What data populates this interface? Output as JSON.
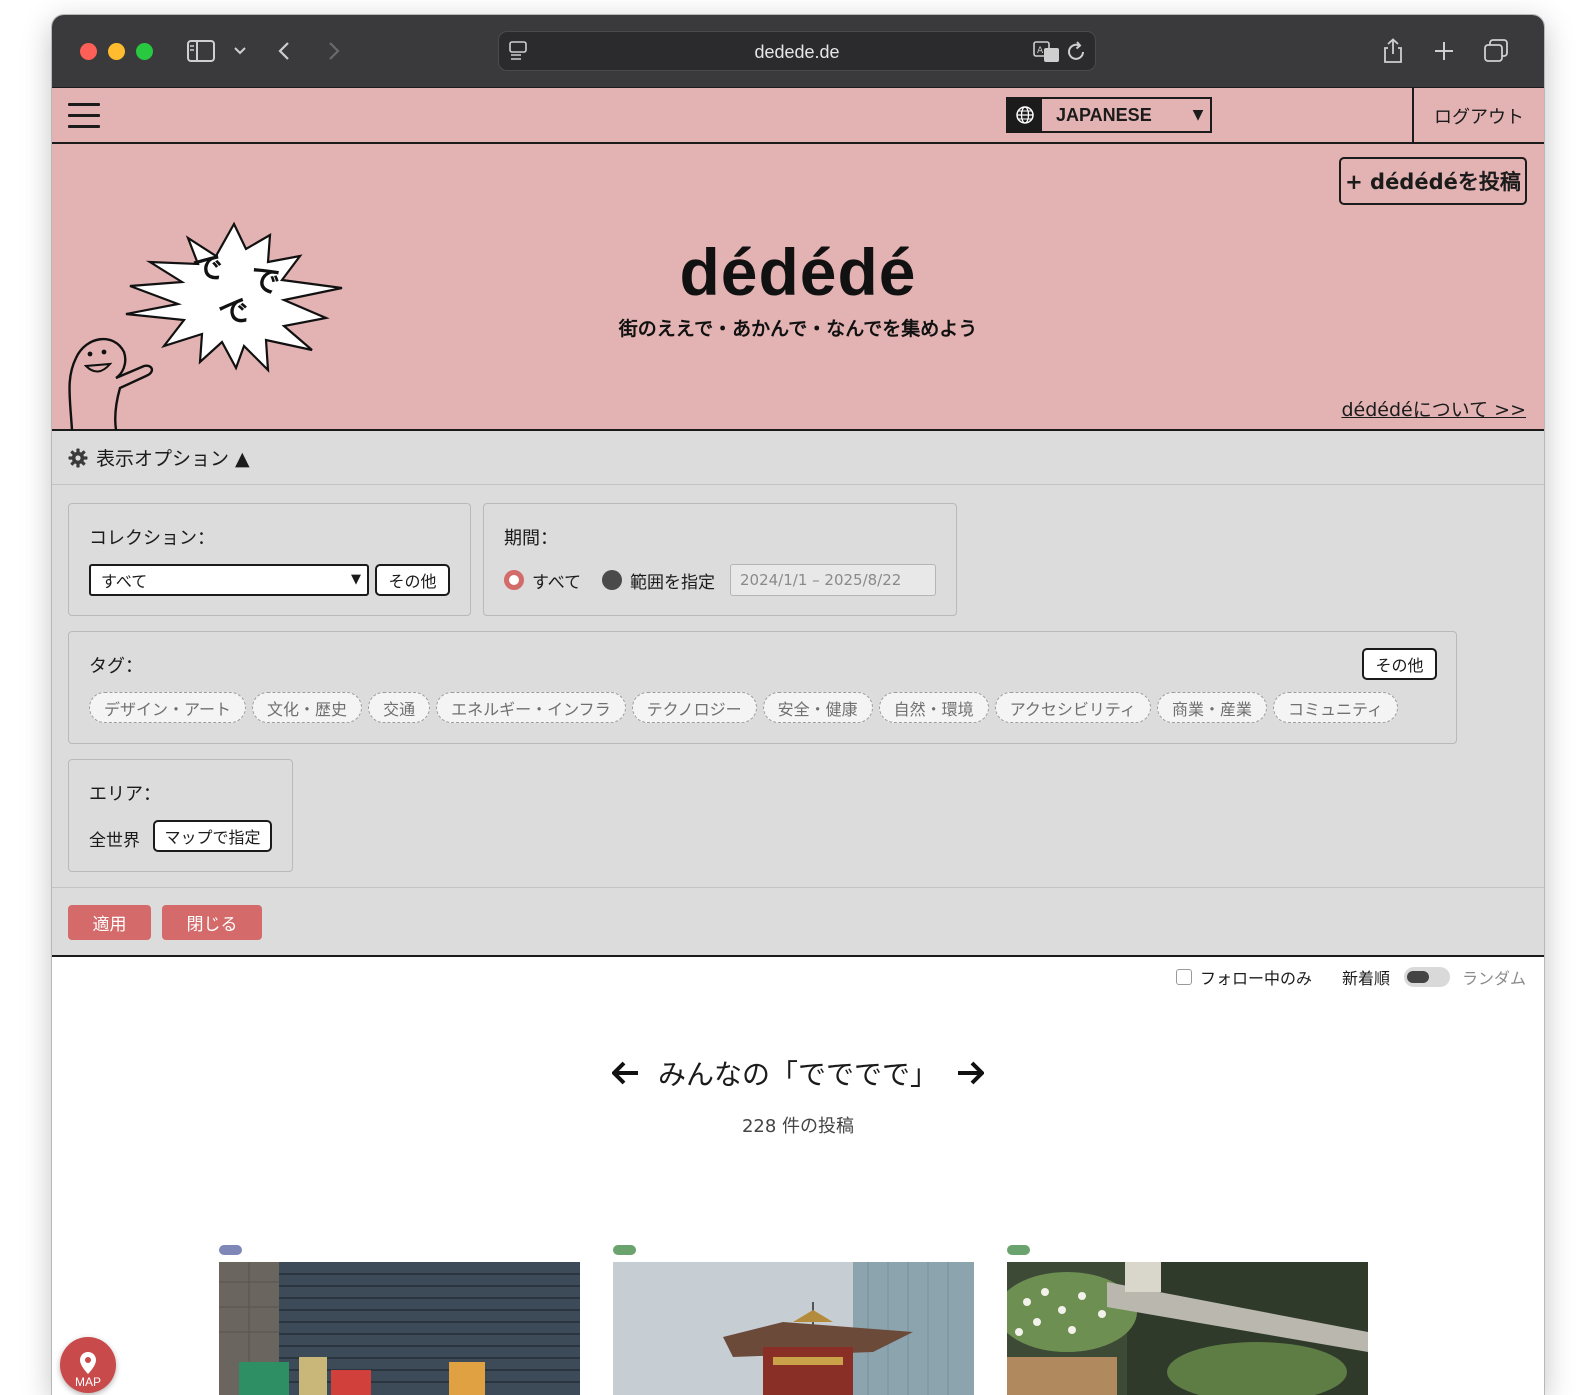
{
  "browser": {
    "url": "dedede.de"
  },
  "topbar": {
    "language": "JAPANESE",
    "logout_label": "ログアウト"
  },
  "hero": {
    "post_button": "+ dédédéを投稿",
    "brand": "dédédé",
    "tagline": "街のええで・あかんで・なんでを集めよう",
    "about_link": "dédédéについて >>",
    "speech_text": [
      "で",
      "で",
      "で"
    ]
  },
  "options": {
    "header": "表示オプション ▲",
    "collection": {
      "label": "コレクション：",
      "selected": "すべて",
      "more_button": "その他"
    },
    "period": {
      "label": "期間：",
      "option_all": "すべて",
      "option_range": "範囲を指定",
      "range_placeholder": "2024/1/1 – 2025/8/22"
    },
    "tags": {
      "label": "タグ：",
      "more_button": "その他",
      "items": [
        "デザイン・アート",
        "文化・歴史",
        "交通",
        "エネルギー・インフラ",
        "テクノロジー",
        "安全・健康",
        "自然・環境",
        "アクセシビリティ",
        "商業・産業",
        "コミュニティ"
      ]
    },
    "area": {
      "label": "エリア：",
      "value": "全世界",
      "map_button": "マップで指定"
    },
    "apply_button": "適用",
    "close_button": "閉じる"
  },
  "feed": {
    "follow_only": "フォロー中のみ",
    "sort_newest": "新着順",
    "sort_random": "ランダム",
    "title": "みんなの「でででで」",
    "count": "228 件の投稿",
    "map_button": "MAP",
    "card_chip_colors": [
      "#7f86b8",
      "#6aa36e",
      "#6aa36e"
    ]
  },
  "colors": {
    "accent_pink": "#e3b3b3",
    "button_red": "#d46a6a"
  }
}
